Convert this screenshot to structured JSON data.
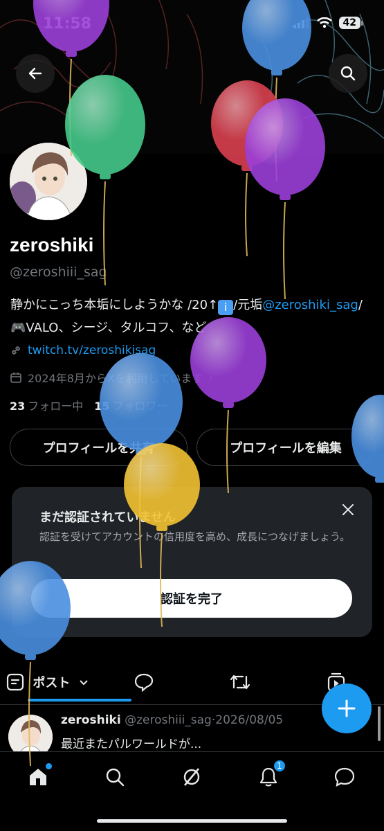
{
  "status_bar": {
    "time": "11:58",
    "battery": "42"
  },
  "profile": {
    "display_name": "zeroshiki",
    "handle": "@zeroshiii_sag",
    "bio_part1": "静かにこっち本垢にしようかな /20↑",
    "bio_part2": "/元垢",
    "bio_mention": "@zeroshiki_sag",
    "bio_part3": "/🎮VALO、シージ、タルコフ、など",
    "link": "twitch.tv/zeroshikisag",
    "joined": "2024年8月からXを利用しています",
    "following_count": "23",
    "following_label": "フォロー中",
    "followers_count": "15",
    "followers_label": "フォロワー"
  },
  "actions": {
    "share": "プロフィールを共有",
    "edit": "プロフィールを編集"
  },
  "verify_card": {
    "title": "まだ認証されていません",
    "description": "認証を受けてアカウントの信用度を高め、成長につなげましょう。",
    "button": "認証を完了"
  },
  "tabs": {
    "posts": "ポスト"
  },
  "tweet": {
    "name": "zeroshiki",
    "handle": "@zeroshiii_sag",
    "date": "2026/08/05",
    "text": "最近またパルワールドが..."
  },
  "notifications_badge": "1",
  "icons": [
    "back-arrow-icon",
    "search-icon",
    "link-icon",
    "calendar-icon",
    "close-icon",
    "posts-icon",
    "chevron-down-icon",
    "reply-icon",
    "repost-icon",
    "video-icon",
    "plus-icon",
    "home-icon",
    "grok-icon",
    "bell-icon",
    "messages-icon"
  ],
  "colors": {
    "accent": "#1d9bf0",
    "background": "#000000",
    "card": "#202327"
  }
}
